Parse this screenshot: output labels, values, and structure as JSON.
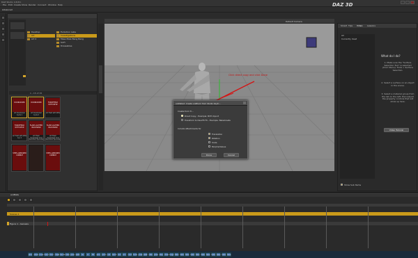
{
  "app": {
    "title": "DAZ Studio 4.6 Pro",
    "logo": "DAZ 3D",
    "nav": [
      "FreeStore",
      "My Account"
    ]
  },
  "menu": [
    "File",
    "Edit",
    "Create",
    "Show",
    "Render",
    "Connect",
    "Window",
    "Help"
  ],
  "workspace_tab": "Advanced",
  "content_tree": {
    "items": [
      "Desktop",
      "Art",
      "Art 2"
    ],
    "selected": 1
  },
  "content_folders": {
    "items": [
      "Evolution Labs",
      "Investigations",
      "Mass Male Bang Bang",
      "SciFi",
      "Dressables"
    ],
    "selected": 1
  },
  "content_count": "1 - 15 of 15",
  "thumbs": [
    {
      "text": "DOORKICKER",
      "cap": "Art Doorkicker Cycle 1"
    },
    {
      "text": "DOORKICKER",
      "cap": "Art Doorkicker Cycle 2"
    },
    {
      "text": "FORCEFIELD WITH RIFLE",
      "cap": "Art Field with Rifle"
    },
    {
      "text": "FORCEFIELD WITH RIFLE",
      "cap": "Art Field with Rifle Cyc 2"
    },
    {
      "text": "FLASH-LIGHTED BACKHAND",
      "cap": "Art Flash Undershed Cmd Backhand Sprocket 1 p 2"
    },
    {
      "text": "FLASH-LIGHTED BACKHAND",
      "cap": "Art Flash Undershed Cmd Backhand Sprocket 2 p 2"
    },
    {
      "text": "STEEL-ARMORED COMBAT",
      "cap": ""
    },
    {
      "text": "",
      "cap": ""
    },
    {
      "text": "STEEL-ARMORED COMBAT",
      "cap": ""
    }
  ],
  "viewport": {
    "camera": "Default Camera",
    "annotation": "Click direct copy and click Done"
  },
  "dialog": {
    "title": "aniMate2: Create aniBlock from Studio Keyfr...",
    "section": "Create from Ti...",
    "option1": "Direct Copy - Example: BVH import",
    "option2": "Transform to DescFit FK - Example: BakeCreate",
    "attach_label": "Include Attachments for",
    "checks": [
      "Translation",
      "Rotation",
      "Scale",
      "Morphs/Values"
    ],
    "buttons": [
      "Done",
      "Cancel"
    ]
  },
  "right_panel": {
    "tabs": [
      "Smart",
      "Tips",
      "Video",
      "Lessons"
    ],
    "list": [
      "All",
      "Currently Used"
    ],
    "heading": "What do I do?",
    "steps": [
      "1. Make sure the \"Surface Selection Tool\" is selected (from Menu). Tools > Surface Selection.",
      "2. Select a surface on an object in the scene.",
      "3. Select a material group from the list on the left, then adjust the property controls that will show up here."
    ],
    "button": "Video Tutorial",
    "checkbox": "Show Sub Items"
  },
  "timeline": {
    "tab": "aniMate",
    "rows": [
      "Scenes 1",
      "Figure 1 - Genesis"
    ]
  },
  "bottom_tabs": [
    "skin",
    "shade",
    "cross",
    "hand",
    "tmor",
    "cheat",
    "hands",
    "roster",
    "pose",
    "walk",
    "lie",
    "lt",
    "fill",
    "arm",
    "norm",
    "cat",
    "bend",
    "out",
    "scn",
    "cont",
    "tools",
    "pose",
    "walk",
    "rate",
    "pose",
    "stop",
    "chain",
    "bugs",
    "take",
    "take",
    "take",
    "take",
    "take",
    "fake",
    "take",
    "take",
    "take",
    "take",
    "take"
  ]
}
